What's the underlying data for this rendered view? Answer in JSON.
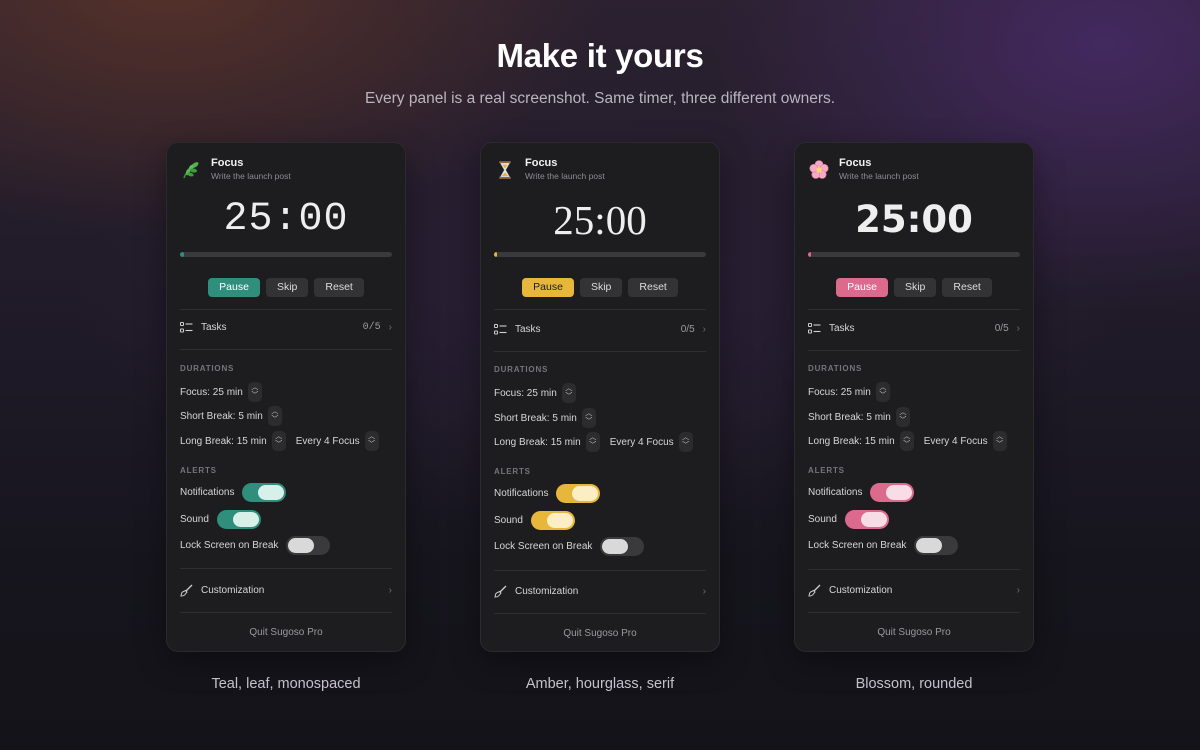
{
  "hero": {
    "title": "Make it yours",
    "subtitle": "Every panel is a real screenshot. Same timer, three different owners."
  },
  "panels": [
    {
      "theme": "mono",
      "accent": "#2f8f7c",
      "knob_color": "#d8f0ea",
      "icon": "leaf-icon",
      "caption": "Teal, leaf, monospaced",
      "title": "Focus",
      "subtitle": "Write the launch post",
      "timer": "25:00",
      "progress": 0.02,
      "buttons": {
        "pause": "Pause",
        "skip": "Skip",
        "reset": "Reset"
      },
      "tasks": {
        "label": "Tasks",
        "count": "0/5"
      },
      "durations": {
        "label": "DURATIONS",
        "focus": "Focus: 25 min",
        "short_break": "Short Break: 5 min",
        "long_break": "Long Break: 15 min",
        "every": "Every 4 Focus"
      },
      "alerts": {
        "label": "ALERTS",
        "notifications": "Notifications",
        "sound": "Sound",
        "lock_screen": "Lock Screen on Break",
        "notifications_on": true,
        "sound_on": true,
        "lock_screen_on": false
      },
      "customization": "Customization",
      "quit": "Quit Sugoso Pro"
    },
    {
      "theme": "serif",
      "accent": "#e6b73a",
      "knob_color": "#fbeec4",
      "icon": "hourglass-icon",
      "caption": "Amber, hourglass, serif",
      "title": "Focus",
      "subtitle": "Write the launch post",
      "timer": "25:00",
      "progress": 0.015,
      "buttons": {
        "pause": "Pause",
        "skip": "Skip",
        "reset": "Reset"
      },
      "tasks": {
        "label": "Tasks",
        "count": "0/5"
      },
      "durations": {
        "label": "DURATIONS",
        "focus": "Focus: 25 min",
        "short_break": "Short Break: 5 min",
        "long_break": "Long Break: 15 min",
        "every": "Every 4 Focus"
      },
      "alerts": {
        "label": "ALERTS",
        "notifications": "Notifications",
        "sound": "Sound",
        "lock_screen": "Lock Screen on Break",
        "notifications_on": true,
        "sound_on": true,
        "lock_screen_on": false
      },
      "customization": "Customization",
      "quit": "Quit Sugoso Pro"
    },
    {
      "theme": "rounded",
      "accent": "#dc6a8d",
      "knob_color": "#f8dde6",
      "icon": "blossom-icon",
      "caption": "Blossom, rounded",
      "title": "Focus",
      "subtitle": "Write the launch post",
      "timer": "25:00",
      "progress": 0.015,
      "buttons": {
        "pause": "Pause",
        "skip": "Skip",
        "reset": "Reset"
      },
      "tasks": {
        "label": "Tasks",
        "count": "0/5"
      },
      "durations": {
        "label": "DURATIONS",
        "focus": "Focus: 25 min",
        "short_break": "Short Break: 5 min",
        "long_break": "Long Break: 15 min",
        "every": "Every 4 Focus"
      },
      "alerts": {
        "label": "ALERTS",
        "notifications": "Notifications",
        "sound": "Sound",
        "lock_screen": "Lock Screen on Break",
        "notifications_on": true,
        "sound_on": true,
        "lock_screen_on": false
      },
      "customization": "Customization",
      "quit": "Quit Sugoso Pro"
    }
  ]
}
